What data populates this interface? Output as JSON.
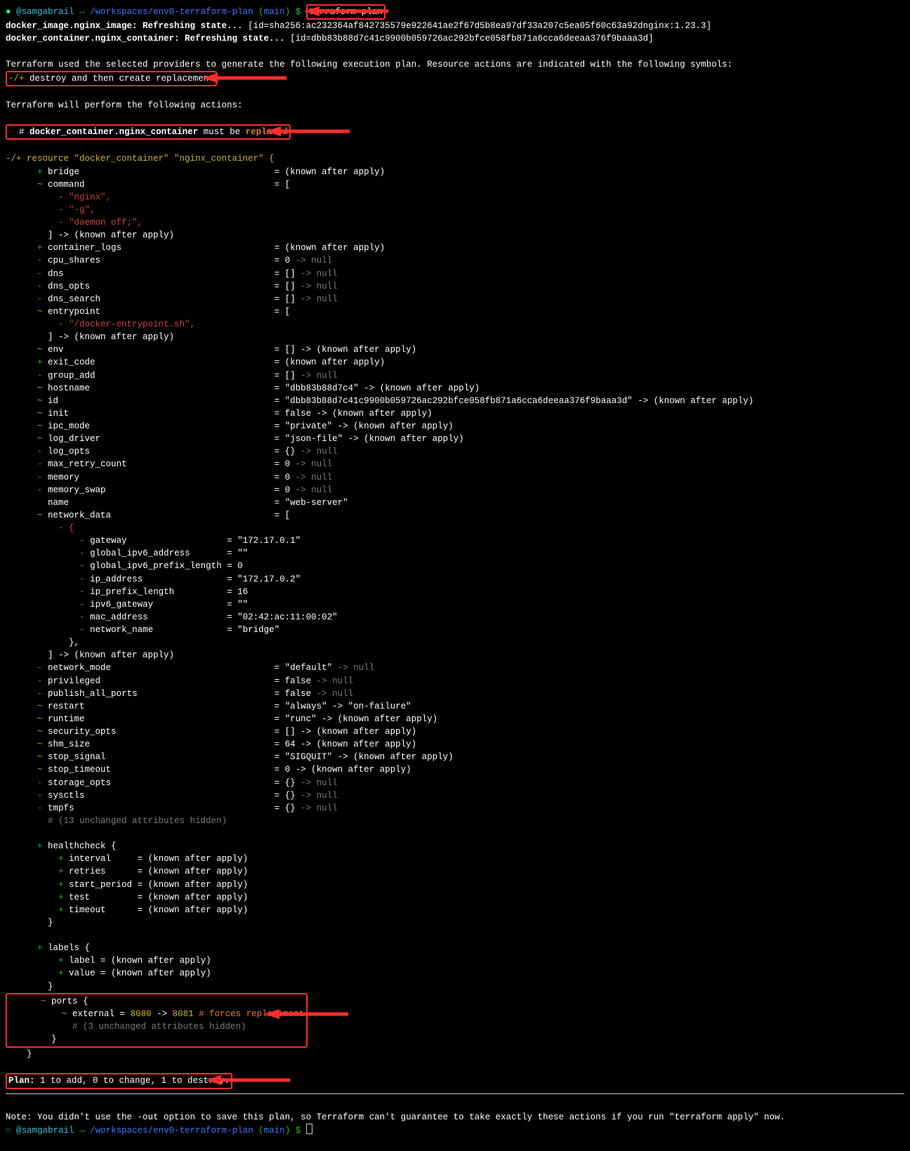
{
  "prompt": {
    "bullet": "●",
    "user": "@samgabrail",
    "arrow": "→",
    "path": "/workspaces/env0-terraform-plan",
    "branch_open": "(",
    "branch": "main",
    "branch_close": ")",
    "dollar": "$",
    "cmd": "terraform plan"
  },
  "refresh": {
    "img": "docker_image.nginx_image: Refreshing state...",
    "img_id": "[id=sha256:ac232364af842735579e922641ae2f67d5b8ea97df33a207c5ea05f60c63a92dnginx:1.23.3]",
    "ctr": "docker_container.nginx_container: Refreshing state...",
    "ctr_id": "[id=dbb83b88d7c41c9900b059726ac292bfce058fb871a6cca6deeaa376f9baaa3d]"
  },
  "intro": {
    "line": "Terraform used the selected providers to generate the following execution plan. Resource actions are indicated with the following symbols:",
    "sym_prefix": "-/+",
    "sym_label": "destroy and then create replacement",
    "perform": "Terraform will perform the following actions:"
  },
  "must": {
    "hash": "#",
    "addr": "docker_container.nginx_container",
    "mid": " must be ",
    "rep": "replaced"
  },
  "res_header": "-/+ resource \"docker_container\" \"nginx_container\" {",
  "attrs": {
    "add": "+",
    "tilde": "~",
    "minus": "-",
    "bridge": {
      "name": "bridge",
      "val": "= (known after apply)"
    },
    "command": {
      "name": "command",
      "val": "= ["
    },
    "cmd1": "- \"nginx\",",
    "cmd2": "- \"-g\",",
    "cmd3": "- \"daemon off;\",",
    "cmd_end": "] -> (known after apply)",
    "clogs": {
      "name": "container_logs",
      "val": "= (known after apply)"
    },
    "cpu": {
      "name": "cpu_shares",
      "val": "= 0",
      "tail": " -> null"
    },
    "dns": {
      "name": "dns",
      "val": "= []",
      "tail": " -> null"
    },
    "dnsopts": {
      "name": "dns_opts",
      "val": "= []",
      "tail": " -> null"
    },
    "dnssrch": {
      "name": "dns_search",
      "val": "= []",
      "tail": " -> null"
    },
    "entry": {
      "name": "entrypoint",
      "val": "= ["
    },
    "entry1": "- \"/docker-entrypoint.sh\",",
    "entry_end": "] -> (known after apply)",
    "env": {
      "name": "env",
      "val": "= [] -> (known after apply)"
    },
    "exit": {
      "name": "exit_code",
      "val": "= (known after apply)"
    },
    "gadd": {
      "name": "group_add",
      "val": "= []",
      "tail": " -> null"
    },
    "host": {
      "name": "hostname",
      "val": "= \"dbb83b88d7c4\" -> (known after apply)"
    },
    "id": {
      "name": "id",
      "val": "= \"dbb83b88d7c41c9900b059726ac292bfce058fb871a6cca6deeaa376f9baaa3d\" -> (known after apply)"
    },
    "init": {
      "name": "init",
      "val": "= false -> (known after apply)"
    },
    "ipc": {
      "name": "ipc_mode",
      "val": "= \"private\" -> (known after apply)"
    },
    "logd": {
      "name": "log_driver",
      "val": "= \"json-file\" -> (known after apply)"
    },
    "logo": {
      "name": "log_opts",
      "val": "= {}",
      "tail": " -> null"
    },
    "maxr": {
      "name": "max_retry_count",
      "val": "= 0",
      "tail": " -> null"
    },
    "mem": {
      "name": "memory",
      "val": "= 0",
      "tail": " -> null"
    },
    "mems": {
      "name": "memory_swap",
      "val": "= 0",
      "tail": " -> null"
    },
    "nm": {
      "name": "name",
      "val": "= \"web-server\""
    },
    "netd": {
      "name": "network_data",
      "val": "= ["
    },
    "nd_open": "- {",
    "nd_gw": {
      "k": "gateway",
      "v": "= \"172.17.0.1\""
    },
    "nd_g6a": {
      "k": "global_ipv6_address",
      "v": "= \"\""
    },
    "nd_g6p": {
      "k": "global_ipv6_prefix_length",
      "v": "= 0"
    },
    "nd_ip": {
      "k": "ip_address",
      "v": "= \"172.17.0.2\""
    },
    "nd_ipl": {
      "k": "ip_prefix_length",
      "v": "= 16"
    },
    "nd_v6g": {
      "k": "ipv6_gateway",
      "v": "= \"\""
    },
    "nd_mac": {
      "k": "mac_address",
      "v": "= \"02:42:ac:11:00:02\""
    },
    "nd_nn": {
      "k": "network_name",
      "v": "= \"bridge\""
    },
    "nd_close": "},",
    "netd_end": "] -> (known after apply)",
    "netm": {
      "name": "network_mode",
      "val": "= \"default\"",
      "tail": " -> null"
    },
    "priv": {
      "name": "privileged",
      "val": "= false",
      "tail": " -> null"
    },
    "pub": {
      "name": "publish_all_ports",
      "val": "= false",
      "tail": " -> null"
    },
    "rest": {
      "name": "restart",
      "val": "= \"always\" -> \"on-failure\""
    },
    "rt": {
      "name": "runtime",
      "val": "= \"runc\" -> (known after apply)"
    },
    "sec": {
      "name": "security_opts",
      "val": "= [] -> (known after apply)"
    },
    "shm": {
      "name": "shm_size",
      "val": "= 64 -> (known after apply)"
    },
    "ssig": {
      "name": "stop_signal",
      "val": "= \"SIGQUIT\" -> (known after apply)"
    },
    "sto": {
      "name": "stop_timeout",
      "val": "= 0 -> (known after apply)"
    },
    "stor": {
      "name": "storage_opts",
      "val": "= {}",
      "tail": " -> null"
    },
    "sys": {
      "name": "sysctls",
      "val": "= {}",
      "tail": " -> null"
    },
    "tmp": {
      "name": "tmpfs",
      "val": "= {}",
      "tail": " -> null"
    },
    "hidden13": "# (13 unchanged attributes hidden)"
  },
  "health": {
    "open": "healthcheck {",
    "interval": "interval     = (known after apply)",
    "retries": "retries      = (known after apply)",
    "start": "start_period = (known after apply)",
    "test": "test         = (known after apply)",
    "timeout": "timeout      = (known after apply)",
    "close": "}"
  },
  "labels": {
    "open": "labels {",
    "label": "label = (known after apply)",
    "value": "value = (known after apply)",
    "close": "}"
  },
  "ports": {
    "open": "ports {",
    "ext_key": "external = ",
    "ext_from": "8080",
    "ext_arrow": " -> ",
    "ext_to": "8081",
    "force": " # forces replacement",
    "hidden": "# (3 unchanged attributes hidden)",
    "close": "}"
  },
  "res_close": "}",
  "plan": {
    "prefix": "Plan:",
    "rest": " 1 to add, 0 to change, 1 to destroy."
  },
  "note": "Note: You didn't use the -out option to save this plan, so Terraform can't guarantee to take exactly these actions if you run \"terraform apply\" now.",
  "prompt2": {
    "bullet": "○",
    "user": "@samgabrail",
    "arrow": "→",
    "path": "/workspaces/env0-terraform-plan",
    "branch_open": "(",
    "branch": "main",
    "branch_close": ")",
    "dollar": "$"
  }
}
